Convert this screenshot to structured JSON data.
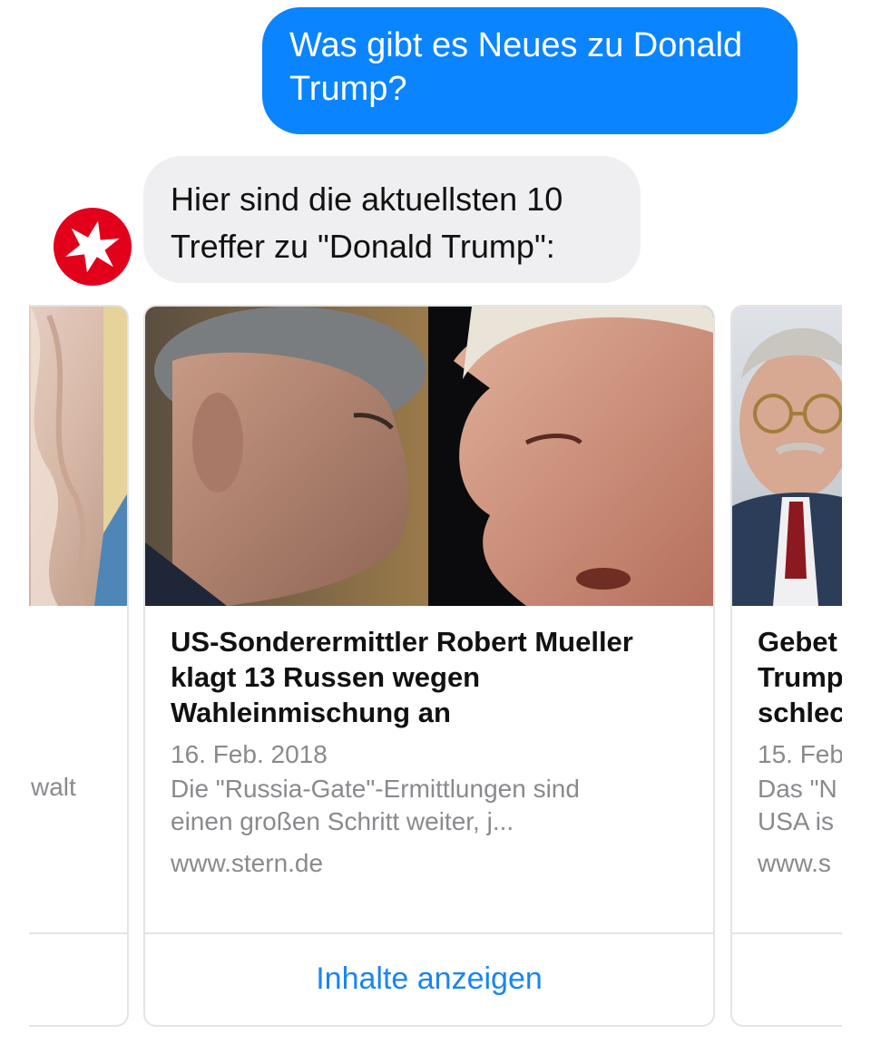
{
  "conversation": {
    "user_message": "Was gibt es Neues zu Donald Trump?",
    "bot_message": "Hier sind die aktuellsten 10 Treffer zu \"Donald Trump\":",
    "bot_avatar_icon": "stern-logo-icon"
  },
  "cards": {
    "left": {
      "snippet": "walt"
    },
    "main": {
      "title": "US-Sonderermittler Robert Mueller\nklagt 13 Russen wegen\nWahleinmischung an",
      "date": "16. Feb. 2018",
      "description": "Die \"Russia-Gate\"-Ermittlungen sind\neinen großen Schritt weiter, j...",
      "domain": "www.stern.de",
      "action": "Inhalte anzeigen"
    },
    "right": {
      "title": "Gebet\nTrump\nschlec",
      "date": "15. Feb",
      "description": "Das \"N\nUSA is",
      "domain": "www.s"
    }
  },
  "colors": {
    "user_bubble": "#0a84ff",
    "bot_bubble": "#efeff1",
    "link": "#1a84f5",
    "stern_red": "#e2001a"
  }
}
